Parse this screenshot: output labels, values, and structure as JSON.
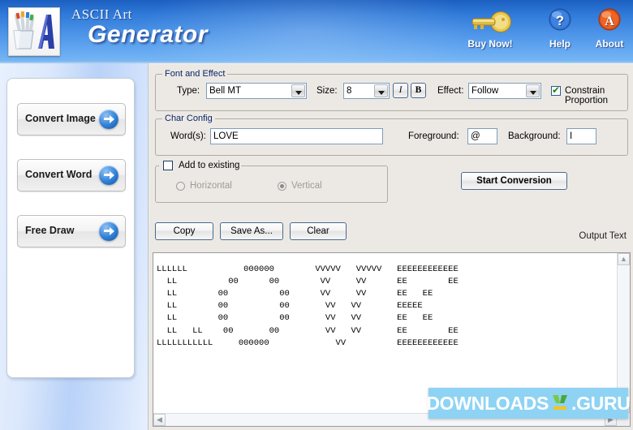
{
  "app": {
    "title_line1": "ASCII Art",
    "title_line2": "Generator",
    "logo_icon": "paintbrush-cup-letter-a-logo"
  },
  "header": {
    "buttons": [
      {
        "id": "buy-now",
        "label": "Buy Now!",
        "icon": "gold-key-icon"
      },
      {
        "id": "help",
        "label": "Help",
        "icon": "blue-question-mark-icon"
      },
      {
        "id": "about",
        "label": "About",
        "icon": "orange-letter-a-icon"
      }
    ],
    "colors": {
      "gradient_top": "#1b5fc1",
      "gradient_bottom": "#7ab9f5"
    }
  },
  "sidebar": {
    "items": [
      {
        "label": "Convert Image",
        "icon": "blue-arrow-right-icon"
      },
      {
        "label": "Convert Word",
        "icon": "blue-arrow-right-icon"
      },
      {
        "label": "Free Draw",
        "icon": "blue-arrow-right-icon"
      }
    ]
  },
  "font_effect": {
    "group_title": "Font and Effect",
    "type_label": "Type:",
    "type_value": "Bell MT",
    "size_label": "Size:",
    "size_value": "8",
    "italic_label": "I",
    "bold_label": "B",
    "effect_label": "Effect:",
    "effect_value": "Follow",
    "constrain_label": "Constrain Proportion",
    "constrain_checked": true
  },
  "char_config": {
    "group_title": "Char Config",
    "words_label": "Word(s):",
    "words_value": "LOVE",
    "words_placeholder": "",
    "foreground_label": "Foreground:",
    "foreground_value": "@",
    "background_label": "Background:",
    "background_value": "I"
  },
  "add_existing": {
    "checkbox_label": "Add to existing",
    "checkbox_checked": false,
    "horizontal_label": "Horizontal",
    "horizontal_selected": false,
    "vertical_label": "Vertical",
    "vertical_selected": true,
    "disabled": true
  },
  "actions": {
    "start_conversion": "Start Conversion",
    "copy": "Copy",
    "save_as": "Save As...",
    "clear": "Clear"
  },
  "output": {
    "label": "Output Text",
    "ascii_art": "LLLLLL           000000        VVVVV   VVVVV   EEEEEEEEEEEE\n  LL          00      00        VV     VV      EE        EE\n  LL        00          00      VV     VV      EE   EE\n  LL        00          00       VV   VV       EEEEE\n  LL        00          00       VV   VV       EE   EE\n  LL   LL    00       00         VV   VV       EE        EE\nLLLLLLLLLLL     000000             VV          EEEEEEEEEEEE",
    "vscroll_up_icon": "chevron-up-icon",
    "vscroll_down_icon": "chevron-down-icon",
    "hscroll_left_icon": "chevron-left-icon",
    "hscroll_right_icon": "chevron-right-icon"
  },
  "watermark": {
    "text_left": "DOWNLOADS",
    "text_right": ".GURU",
    "icon": "green-download-arrow-icon",
    "background": "#8ed3f4"
  }
}
